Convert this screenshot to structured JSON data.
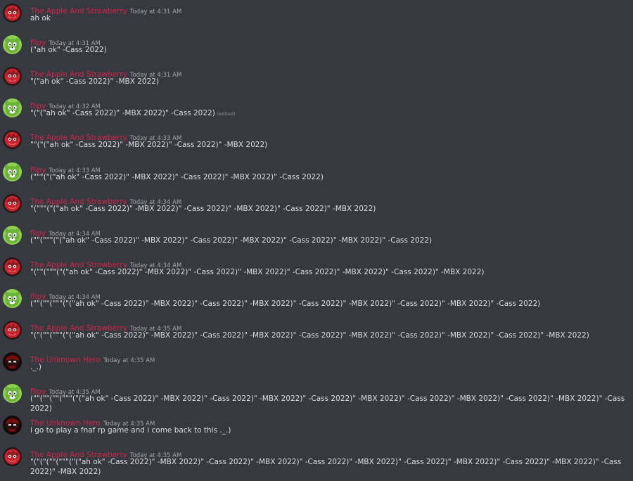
{
  "colors": {
    "background": "#36393f",
    "author_color": "#d1244a",
    "timestamp_color": "#a3a6aa",
    "text_color": "#dcddde"
  },
  "avatars": {
    "apple": {
      "icon": "red-cartoon-character-avatar",
      "bg": "#2b1416",
      "fg": "#c9252f"
    },
    "flipy": {
      "icon": "green-bear-avatar",
      "bg": "#8fd14f",
      "fg": "#6cb33a"
    },
    "hero": {
      "icon": "dark-masked-character-avatar",
      "bg": "#170808",
      "fg": "#7a0d0d"
    }
  },
  "messages": [
    {
      "author": "The Apple And Strawberry",
      "avatar": "apple",
      "timestamp": "Today at 4:31 AM",
      "content": "ah ok",
      "edited": ""
    },
    {
      "author": "flipy",
      "avatar": "flipy",
      "timestamp": "Today at 4:31 AM",
      "content": "(\"ah ok\" -Cass 2022)",
      "edited": ""
    },
    {
      "author": "The Apple And Strawberry",
      "avatar": "apple",
      "timestamp": "Today at 4:31 AM",
      "content": "\"(\"ah ok\" -Cass 2022)\" -MBX 2022)",
      "edited": ""
    },
    {
      "author": "flipy",
      "avatar": "flipy",
      "timestamp": "Today at 4:32 AM",
      "content": "\"(\"(\"ah ok\" -Cass 2022)\" -MBX 2022)\" -Cass 2022)",
      "edited": "(edited)"
    },
    {
      "author": "The Apple And Strawberry",
      "avatar": "apple",
      "timestamp": "Today at 4:33 AM",
      "content": "\"\"(\"(\"ah ok\" -Cass 2022)\" -MBX 2022)\" -Cass 2022)\" -MBX 2022)",
      "edited": ""
    },
    {
      "author": "flipy",
      "avatar": "flipy",
      "timestamp": "Today at 4:33 AM",
      "content": "(\"\"\"(\"(\"ah ok\" -Cass 2022)\" -MBX 2022)\" -Cass 2022)\" -MBX 2022)\" -Cass 2022)",
      "edited": ""
    },
    {
      "author": "The Apple And Strawberry",
      "avatar": "apple",
      "timestamp": "Today at 4:34 AM",
      "content": "\"(\"\"\"(\"(\"ah ok\" -Cass 2022)\" -MBX 2022)\" -Cass 2022)\" -MBX 2022)\" -Cass 2022)\" -MBX 2022)",
      "edited": ""
    },
    {
      "author": "flipy",
      "avatar": "flipy",
      "timestamp": "Today at 4:34 AM",
      "content": "(\"\"(\"\"\"(\"(\"ah ok\" -Cass 2022)\" -MBX 2022)\" -Cass 2022)\" -MBX 2022)\" -Cass 2022)\" -MBX 2022)\" -Cass 2022)",
      "edited": ""
    },
    {
      "author": "The Apple And Strawberry",
      "avatar": "apple",
      "timestamp": "Today at 4:34 AM",
      "content": "\"(\"\"(\"\"\"(\"(\"ah ok\" -Cass 2022)\" -MBX 2022)\" -Cass 2022)\" -MBX 2022)\" -Cass 2022)\" -MBX 2022)\" -Cass 2022)\" -MBX 2022)",
      "edited": ""
    },
    {
      "author": "flipy",
      "avatar": "flipy",
      "timestamp": "Today at 4:34 AM",
      "content": "(\"\"(\"\"(\"\"\"(\"(\"ah ok\" -Cass 2022)\" -MBX 2022)\" -Cass 2022)\" -MBX 2022)\" -Cass 2022)\" -MBX 2022)\" -Cass 2022)\" -MBX 2022)\" -Cass 2022)",
      "edited": ""
    },
    {
      "author": "The Apple And Strawberry",
      "avatar": "apple",
      "timestamp": "Today at 4:35 AM",
      "content": "\"(\"(\"\"(\"\"\"(\"(\"ah ok\" -Cass 2022)\" -MBX 2022)\" -Cass 2022)\" -MBX 2022)\" -Cass 2022)\" -MBX 2022)\" -Cass 2022)\" -MBX 2022)\" -Cass 2022)\" -MBX 2022)",
      "edited": ""
    },
    {
      "author": "The Unknown Hero",
      "avatar": "hero",
      "timestamp": "Today at 4:35 AM",
      "content": "._.)",
      "edited": ""
    },
    {
      "author": "flipy",
      "avatar": "flipy",
      "timestamp": "Today at 4:35 AM",
      "content": "(\"\"(\"\"(\"\"(\"\"\"(\"(\"ah ok\" -Cass 2022)\" -MBX 2022)\" -Cass 2022)\" -MBX 2022)\" -Cass 2022)\" -MBX 2022)\" -Cass 2022)\" -MBX 2022)\" -Cass 2022)\" -MBX 2022)\" -Cass 2022)",
      "edited": ""
    },
    {
      "author": "The Unknown Hero",
      "avatar": "hero",
      "timestamp": "Today at 4:35 AM",
      "content": "i go to play a fnaf rp game and i come back to this ._.)",
      "edited": ""
    },
    {
      "author": "The Apple And Strawberry",
      "avatar": "apple",
      "timestamp": "Today at 4:35 AM",
      "content": "\"(\"(\"(\"\"(\"\"\"(\"(\"ah ok\" -Cass 2022)\" -MBX 2022)\" -Cass 2022)\" -MBX 2022)\" -Cass 2022)\" -MBX 2022)\" -Cass 2022)\" -MBX 2022)\" -Cass 2022)\" -MBX 2022)\" -Cass 2022)\" -MBX 2022)",
      "edited": ""
    }
  ]
}
